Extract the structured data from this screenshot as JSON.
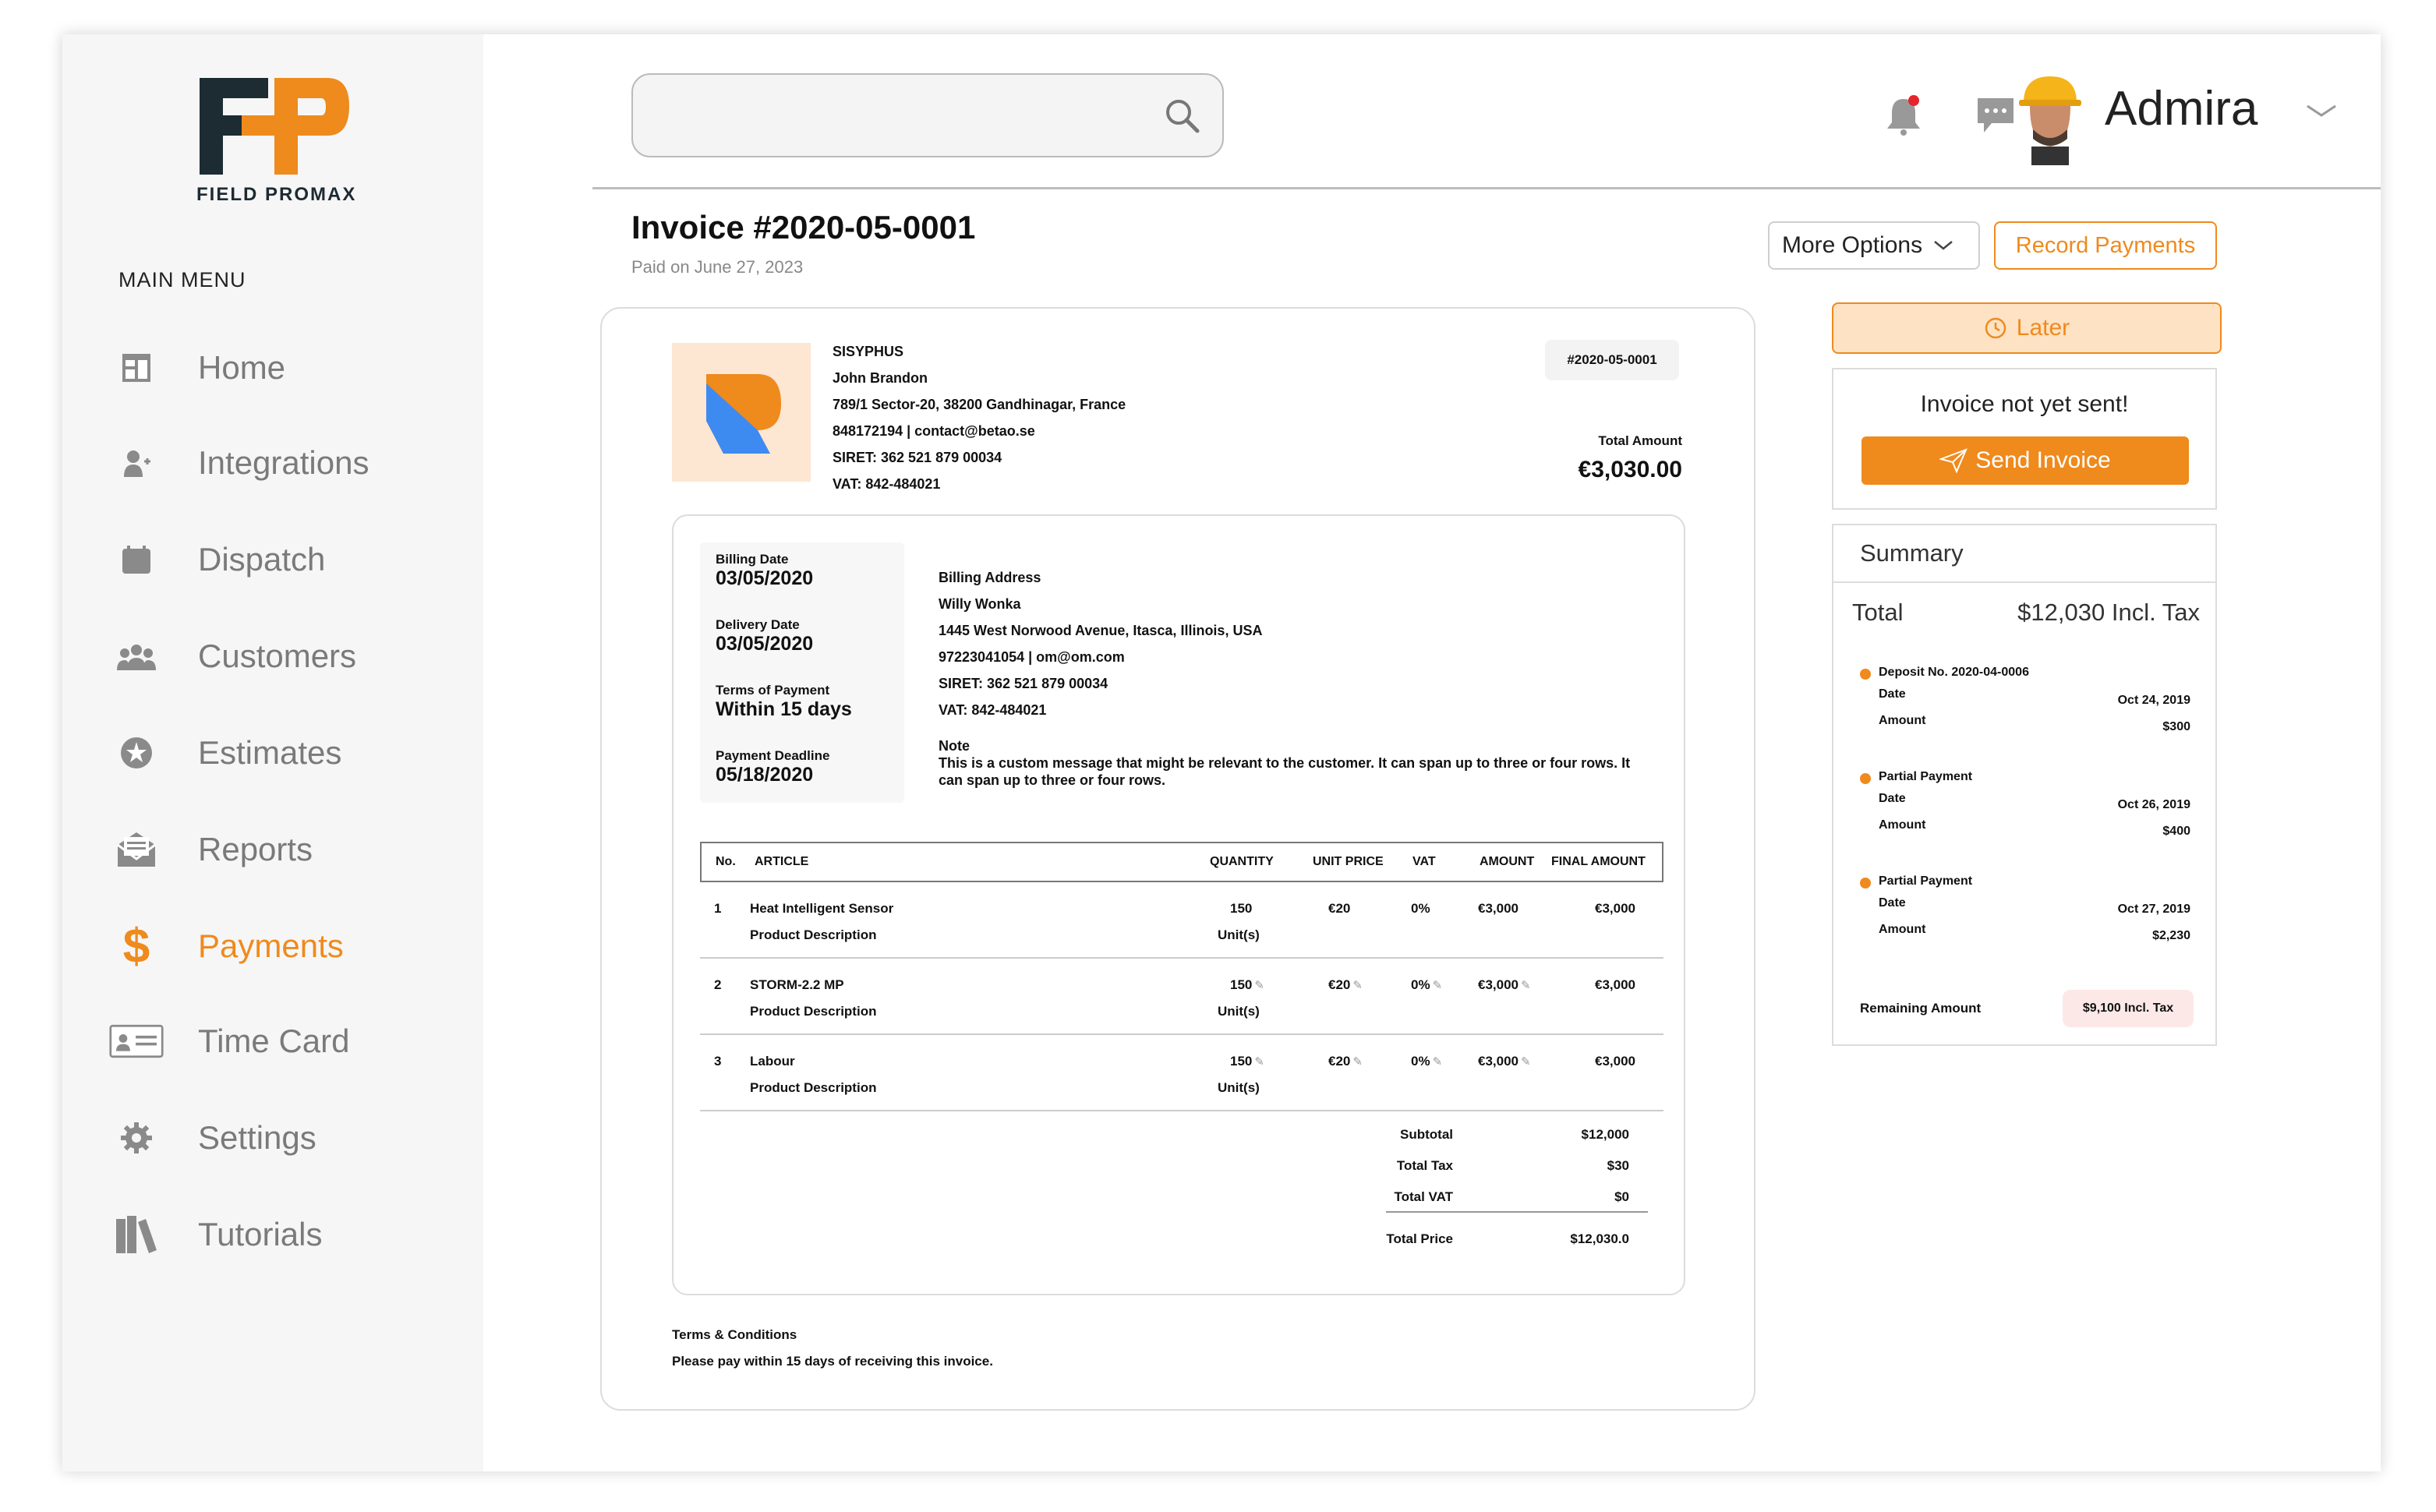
{
  "brand": {
    "logo_text": "FIELD PROMAX",
    "accent": "#ef8a1d",
    "dark": "#1d2b33"
  },
  "sidebar": {
    "menu_title": "MAIN MENU",
    "items": [
      {
        "label": "Home",
        "icon": "home-icon"
      },
      {
        "label": "Integrations",
        "icon": "integrations-icon"
      },
      {
        "label": "Dispatch",
        "icon": "dispatch-icon"
      },
      {
        "label": "Customers",
        "icon": "customers-icon"
      },
      {
        "label": "Estimates",
        "icon": "estimates-icon"
      },
      {
        "label": "Reports",
        "icon": "reports-icon"
      },
      {
        "label": "Payments",
        "icon": "dollar-icon",
        "active": true
      },
      {
        "label": "Time Card",
        "icon": "time-card-icon"
      },
      {
        "label": "Settings",
        "icon": "gear-icon"
      },
      {
        "label": "Tutorials",
        "icon": "tutorials-icon"
      }
    ]
  },
  "header": {
    "search_placeholder": "",
    "user_name": "Admira"
  },
  "invoice": {
    "title": "Invoice #2020-05-0001",
    "paid_on": "Paid on June 27, 2023",
    "more_options": "More Options",
    "record_payments": "Record Payments",
    "company": {
      "name": "SISYPHUS",
      "contact": "John Brandon",
      "address": "789/1 Sector-20, 38200 Gandhinagar, France",
      "phone_email": "848172194 | contact@betao.se",
      "siret": "SIRET: 362 521 879 00034",
      "vat": "VAT: 842-484021"
    },
    "number_tag": "#2020-05-0001",
    "total_amount_label": "Total Amount",
    "total_amount": "€3,030.00",
    "dates": {
      "billing_label": "Billing Date",
      "billing": "03/05/2020",
      "delivery_label": "Delivery Date",
      "delivery": "03/05/2020",
      "terms_label": "Terms of Payment",
      "terms": "Within 15 days",
      "deadline_label": "Payment Deadline",
      "deadline": "05/18/2020"
    },
    "billing": {
      "label": "Billing Address",
      "name": "Willy Wonka",
      "address": "1445 West Norwood Avenue, Itasca, Illinois, USA",
      "phone_email": "97223041054 | om@om.com",
      "siret": "SIRET: 362 521 879 00034",
      "vat": "VAT: 842-484021"
    },
    "note_label": "Note",
    "note": "This is a custom message that might be relevant to the customer. It can span up to three or four rows. It can span up to three or four rows.",
    "columns": {
      "no": "No.",
      "article": "ARTICLE",
      "quantity": "QUANTITY",
      "unit_price": "UNIT PRICE",
      "vat": "VAT",
      "amount": "AMOUNT",
      "final": "FINAL AMOUNT"
    },
    "rows": [
      {
        "no": "1",
        "article": "Heat Intelligent Sensor",
        "desc": "Product Description",
        "qty": "150",
        "unit": "Unit(s)",
        "price": "€20",
        "vat": "0%",
        "amount": "€3,000",
        "final": "€3,000",
        "editable": false
      },
      {
        "no": "2",
        "article": "STORM-2.2 MP",
        "desc": "Product Description",
        "qty": "150",
        "unit": "Unit(s)",
        "price": "€20",
        "vat": "0%",
        "amount": "€3,000",
        "final": "€3,000",
        "editable": true
      },
      {
        "no": "3",
        "article": "Labour",
        "desc": "Product Description",
        "qty": "150",
        "unit": "Unit(s)",
        "price": "€20",
        "vat": "0%",
        "amount": "€3,000",
        "final": "€3,000",
        "editable": true
      }
    ],
    "totals": {
      "subtotal_label": "Subtotal",
      "subtotal": "$12,000",
      "tax_label": "Total Tax",
      "tax": "$30",
      "vat_label": "Total VAT",
      "vat": "$0",
      "price_label": "Total Price",
      "price": "$12,030.0"
    },
    "terms_label": "Terms & Conditions",
    "terms_text": "Please pay within 15 days of receiving this invoice."
  },
  "actions": {
    "later": "Later",
    "not_sent": "Invoice not yet sent!",
    "send": "Send Invoice"
  },
  "summary": {
    "title": "Summary",
    "total_label": "Total",
    "total_value": "$12,030 Incl. Tax",
    "entries": [
      {
        "title": "Deposit No. 2020-04-0006",
        "date_label": "Date",
        "date": "Oct 24, 2019",
        "amount_label": "Amount",
        "amount": "$300"
      },
      {
        "title": "Partial Payment",
        "date_label": "Date",
        "date": "Oct 26, 2019",
        "amount_label": "Amount",
        "amount": "$400"
      },
      {
        "title": "Partial Payment",
        "date_label": "Date",
        "date": "Oct 27, 2019",
        "amount_label": "Amount",
        "amount": "$2,230"
      }
    ],
    "remaining_label": "Remaining Amount",
    "remaining_value": "$9,100 Incl. Tax"
  }
}
